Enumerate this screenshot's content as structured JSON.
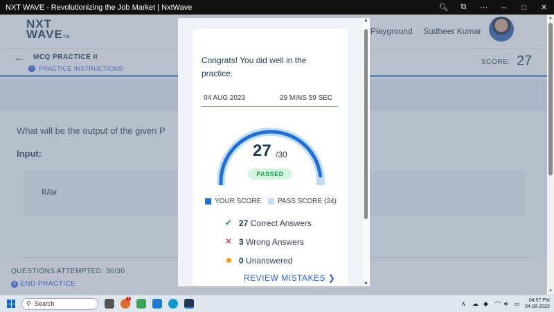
{
  "window": {
    "title": "NXT WAVE - Revolutionizing the Job Market | NxtWave",
    "controls": [
      "zoom",
      "tabs",
      "more",
      "minimize",
      "maximize",
      "close"
    ]
  },
  "header": {
    "logo_line1": "NXT",
    "logo_line2": "WAVE",
    "logo_tm": "TM",
    "nav": [
      "Playground",
      "Sudheer Kumar"
    ]
  },
  "practice": {
    "title": "MCQ PRACTICE II",
    "instructions_link": "PRACTICE INSTRUCTIONS",
    "score_label": "SCORE:",
    "score_value": "27"
  },
  "question": {
    "text": "What will be the output of the given P",
    "input_label": "Input:",
    "code": "RAW"
  },
  "footer": {
    "attempted": "QUESTIONS ATTEMPTED: 30/30",
    "end_practice": "END PRACTICE"
  },
  "result": {
    "message": "Congrats! You did well in the practice.",
    "date": "04 AUG 2023",
    "duration": "29 MINS 59 SEC",
    "score": "27",
    "total": "/30",
    "score_fraction": 0.9,
    "pass_fraction": 0.8,
    "status": "PASSED",
    "legend": {
      "your_score": "YOUR SCORE",
      "pass_score": "PASS SCORE (24)"
    },
    "stats": {
      "correct_count": "27",
      "correct_label": "Correct Answers",
      "wrong_count": "3",
      "wrong_label": "Wrong Answers",
      "unanswered_count": "0",
      "unanswered_label": "Unanswered"
    },
    "review_button": "REVIEW MISTAKES",
    "colors": {
      "your_score": "#1e6fd9",
      "pass_score": "#c3ddf6",
      "passed_bg": "#d6f5e0",
      "correct": "#16a34a",
      "wrong": "#dc2626",
      "unanswered": "#f59e0b"
    }
  },
  "taskbar": {
    "search_placeholder": "Search",
    "notification_badge": "1",
    "time": "04:57 PM",
    "date": "04-08-2023"
  }
}
